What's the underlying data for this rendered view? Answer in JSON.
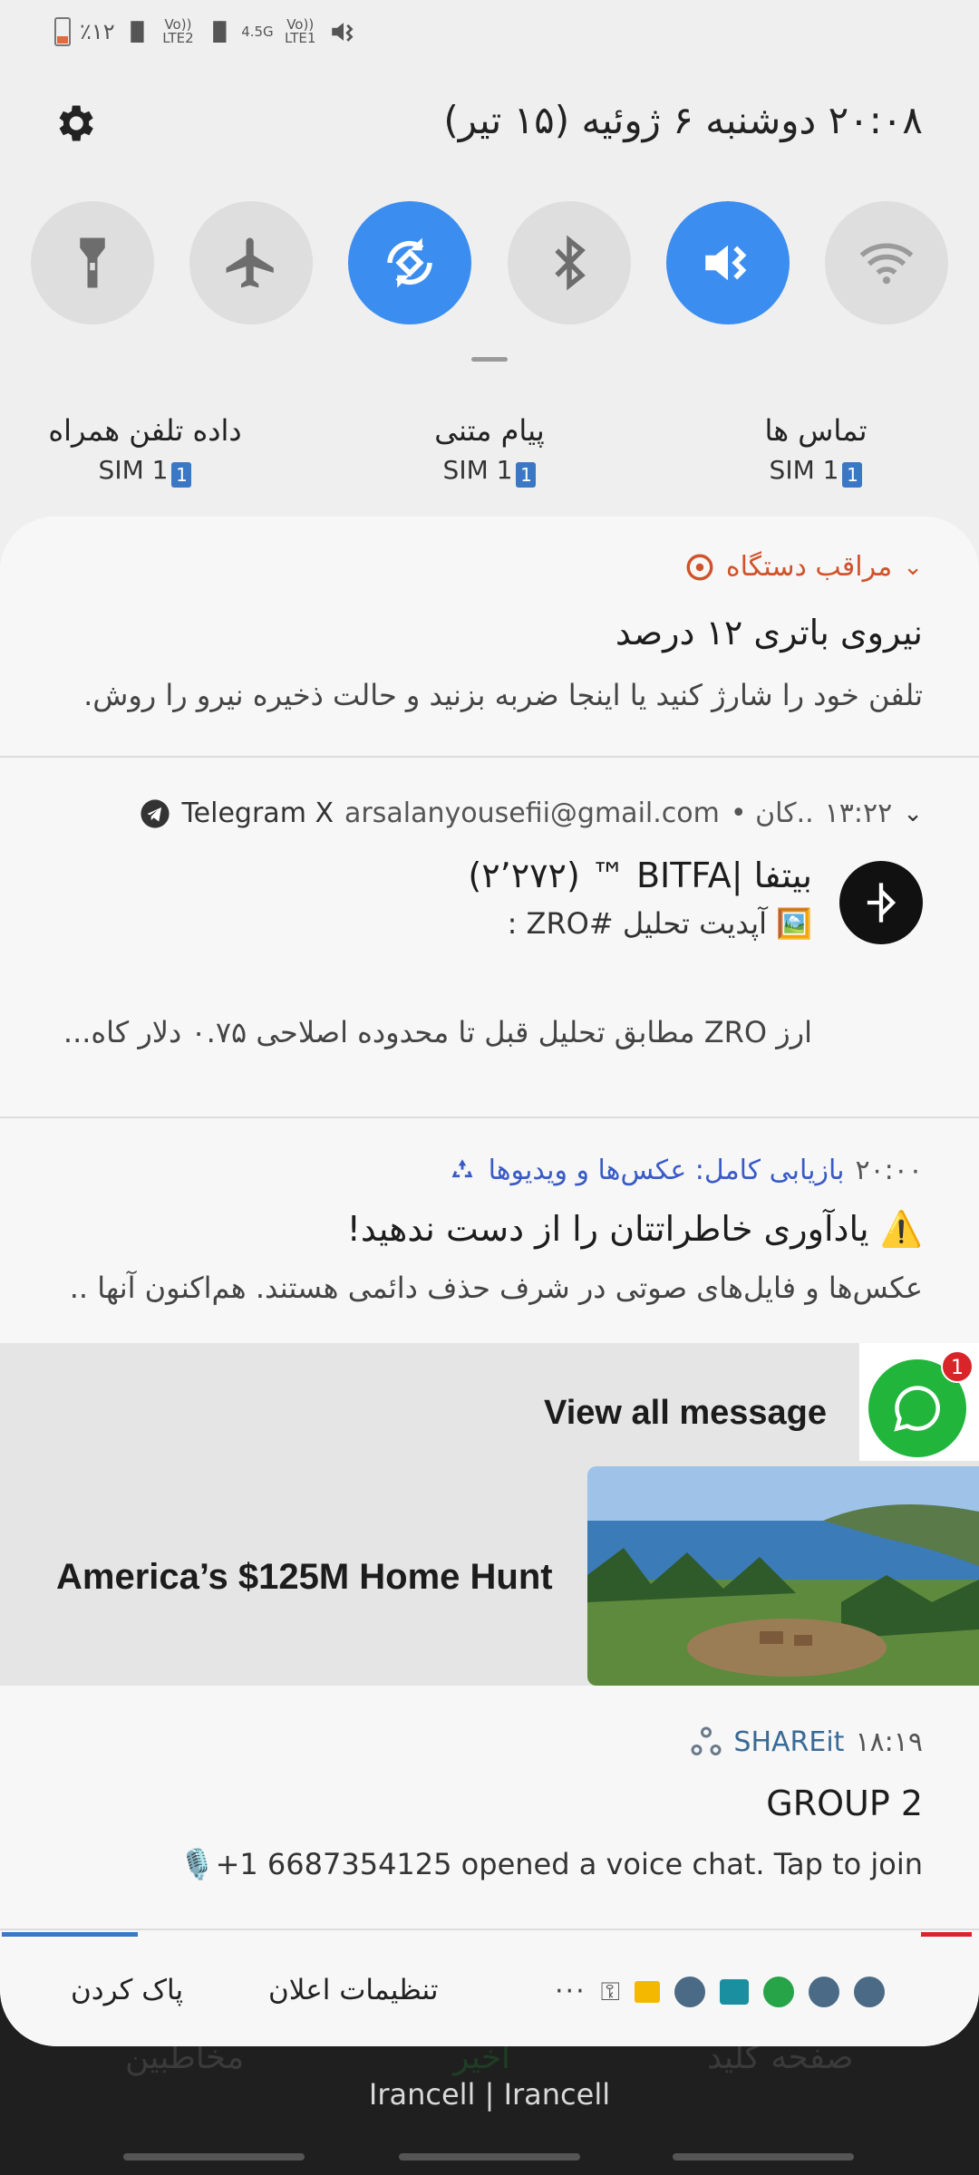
{
  "status_bar": {
    "battery_percent": "٪۱۲",
    "lte2": "Vo)) LTE2",
    "net": "4.5G",
    "lte1": "Vo)) LTE1"
  },
  "header": {
    "datetime": "۲۰:۰۸  دوشنبه ۶ ژوئیه (۱۵ تیر)"
  },
  "toggles": [
    {
      "name": "flashlight",
      "on": false
    },
    {
      "name": "airplane",
      "on": false
    },
    {
      "name": "auto-rotate",
      "on": true
    },
    {
      "name": "bluetooth",
      "on": false
    },
    {
      "name": "mute",
      "on": true
    },
    {
      "name": "wifi",
      "on": false
    }
  ],
  "sim": {
    "calls": {
      "label": "تماس ها",
      "sim": "SIM 1"
    },
    "sms": {
      "label": "پیام متنی",
      "sim": "SIM 1"
    },
    "data": {
      "label": "داده تلفن همراه",
      "sim": "SIM 1"
    },
    "badge": "1"
  },
  "notifications": {
    "device_care": {
      "app": "مراقب دستگاه",
      "title": "نیروی باتری ۱۲ درصد",
      "body": "تلفن خود را شارژ کنید یا اینجا ضربه بزنید و حالت ذخیره نیرو را روش."
    },
    "telegram": {
      "app": "Telegram X",
      "account": "arsalanyousefii@gmail.com",
      "chat_short": "• کان..",
      "time": "۱۳:۲۲",
      "title": "بیتفا |BITFA ™ (۲٬۲۷۲)",
      "line1": "🖼️ آپدیت تحلیل #ZRO :",
      "line2": "ارز ZRO مطابق تحلیل قبل تا محدوده اصلاحی ۰.۷۵ دلار کاه..."
    },
    "recovery": {
      "app": "بازیابی کامل: عکس‌ها و ویدیوها",
      "time": "۲۰:۰۰",
      "title": "⚠️ یادآوری خاطراتتان را از دست ندهید!",
      "body": "عکس‌ها و فایل‌های صوتی در شرف حذف دائمی هستند. هم‌اکنون آنها .."
    },
    "ad": {
      "view_all": "View all message",
      "badge": "1",
      "headline": "America’s $125M Home Hunt"
    },
    "shareit": {
      "app": "SHAREit",
      "time": "۱۸:۱۹",
      "title": "GROUP 2",
      "body": "🎙️+1 6687354125 opened a voice chat. Tap to join"
    }
  },
  "actions": {
    "clear": "پاک کردن",
    "settings": "تنظیمات اعلان",
    "more": "···"
  },
  "background_nav": {
    "home": "صفحه کلید",
    "recent": "اخیر",
    "contacts": "مخاطبین"
  },
  "carrier": "Irancell | Irancell",
  "colors": {
    "accent": "#3b8ef0",
    "device_care": "#d0532b",
    "recovery": "#3a5bc7"
  }
}
